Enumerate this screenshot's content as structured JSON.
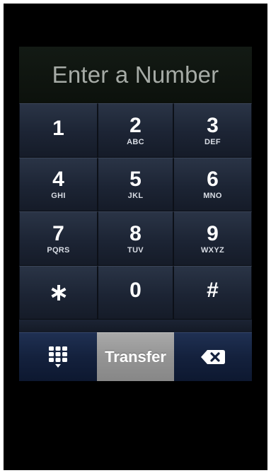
{
  "display": {
    "placeholder": "Enter a Number"
  },
  "keys": [
    {
      "digit": "1",
      "letters": ""
    },
    {
      "digit": "2",
      "letters": "ABC"
    },
    {
      "digit": "3",
      "letters": "DEF"
    },
    {
      "digit": "4",
      "letters": "GHI"
    },
    {
      "digit": "5",
      "letters": "JKL"
    },
    {
      "digit": "6",
      "letters": "MNO"
    },
    {
      "digit": "7",
      "letters": "PQRS"
    },
    {
      "digit": "8",
      "letters": "TUV"
    },
    {
      "digit": "9",
      "letters": "WXYZ"
    },
    {
      "digit": "*",
      "letters": ""
    },
    {
      "digit": "0",
      "letters": ""
    },
    {
      "digit": "#",
      "letters": ""
    }
  ],
  "bottom_bar": {
    "keypad_icon": "keypad-icon",
    "transfer_label": "Transfer",
    "delete_icon": "backspace-icon"
  },
  "colors": {
    "key_gradient_top": "#2a3446",
    "key_gradient_bottom": "#151b28",
    "transfer_button": "#949494",
    "bottom_bar": "#14213d",
    "display_text": "#a6aba6"
  }
}
